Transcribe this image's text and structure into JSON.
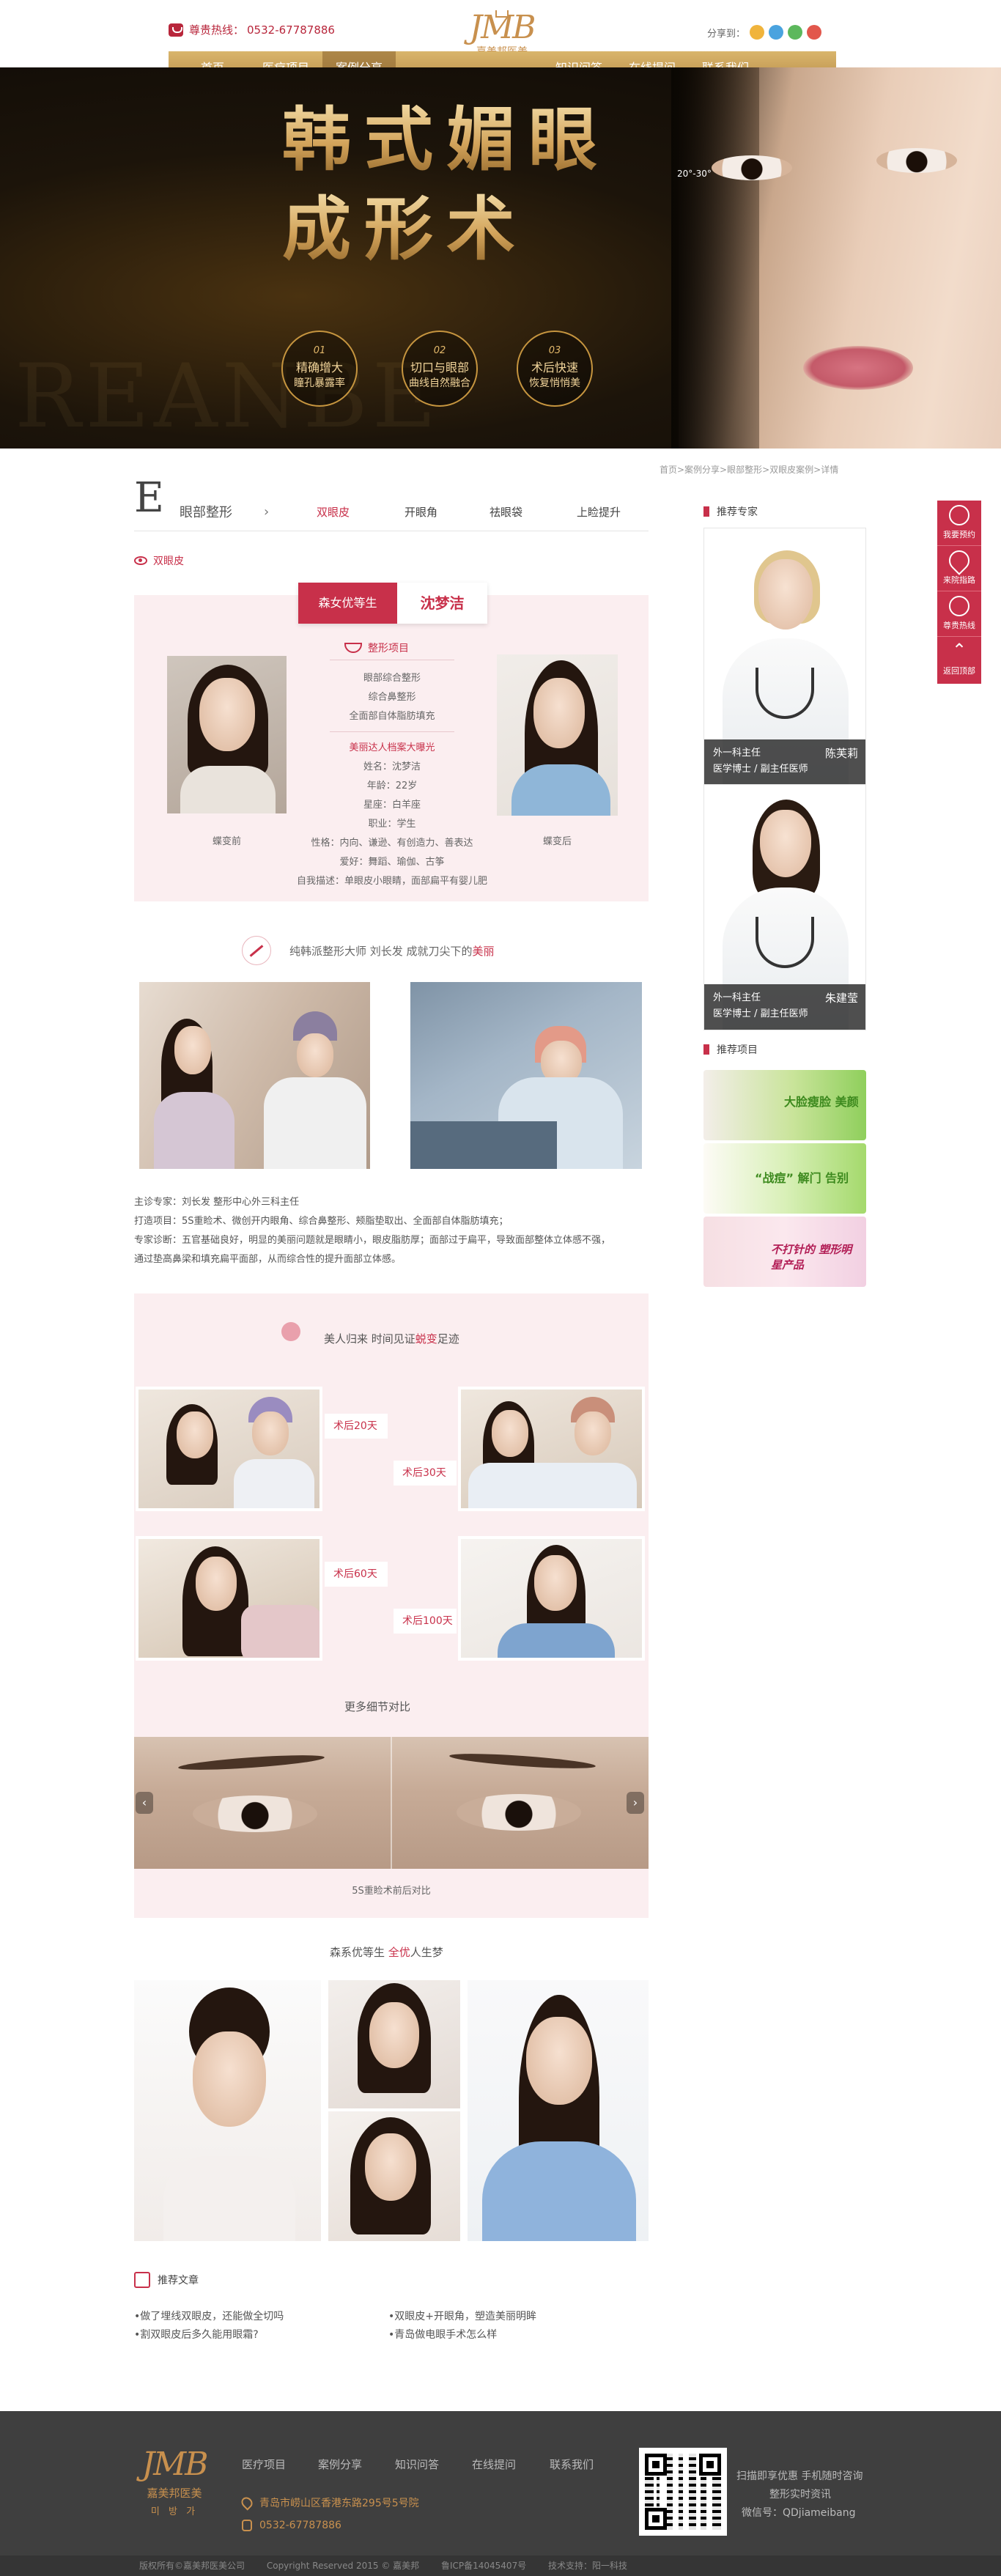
{
  "header": {
    "hotline_label": "尊贵热线：",
    "hotline_number": "0532-67787886",
    "logo_mark": "JMB",
    "logo_name": "嘉美邦医美",
    "share_label": "分享到："
  },
  "nav": [
    "首页",
    "医疗项目",
    "案例分享",
    "知识问答",
    "在线提问",
    "联系我们"
  ],
  "banner": {
    "title_line1": "韩式媚眼",
    "title_line2": "成形术",
    "angle": "20°-30°",
    "bg_text": "REANBE",
    "features": [
      {
        "num": "01",
        "l1": "精确增大",
        "l2": "瞳孔暴露率"
      },
      {
        "num": "02",
        "l1": "切口与眼部",
        "l2": "曲线自然融合"
      },
      {
        "num": "03",
        "l1": "术后快速",
        "l2": "恢复悄悄美"
      }
    ]
  },
  "breadcrumb": "首页>案例分享>眼部整形>双眼皮案例>详情",
  "section": {
    "letter": "E",
    "title": "眼部整形",
    "tabs": [
      "双眼皮",
      "开眼角",
      "祛眼袋",
      "上睑提升"
    ],
    "active_tab": "双眼皮",
    "sub_title": "双眼皮"
  },
  "case": {
    "tag_left": "森女优等生",
    "tag_right": "沈梦洁",
    "project_title": "整形项目",
    "projects": [
      "眼部综合整形",
      "综合鼻整形",
      "全面部自体脂肪填充"
    ],
    "archive_title": "美丽达人档案大曝光",
    "profile": [
      "姓名：沈梦洁",
      "年龄：22岁",
      "星座：白羊座",
      "职业：学生",
      "性格：内向、谦逊、有创造力、善表达",
      "爱好：舞蹈、瑜伽、古筝",
      "自我描述：单眼皮小眼睛，面部扁平有婴儿肥"
    ],
    "before_label": "蝶变前",
    "after_label": "蝶变后"
  },
  "slogan": {
    "prefix": "纯韩派整形大师 刘长发 成就刀尖下的",
    "highlight": "美丽"
  },
  "description": [
    "主诊专家：刘长发 整形中心外三科主任",
    "打造项目：5S重睑术、微创开内眼角、综合鼻整形、颊脂垫取出、全面部自体脂肪填充；",
    "专家诊断：五官基础良好，明显的美丽问题就是眼睛小，眼皮脂肪厚；面部过于扁平，导致面部整体立体感不强，",
    "通过垫高鼻梁和填充扁平面部，从而综合性的提升面部立体感。"
  ],
  "timeline": {
    "head_prefix": "美人归来 时间见证",
    "head_highlight": "蜕变",
    "head_suffix": "足迹",
    "labels": [
      "术后20天",
      "术后30天",
      "术后60天",
      "术后100天"
    ],
    "more": "更多细节对比",
    "strip_caption": "5S重睑术前后对比"
  },
  "joy": {
    "prefix": "森系优等生 ",
    "highlight": "全优",
    "suffix": "人生梦"
  },
  "articles": {
    "title": "推荐文章",
    "items": [
      "•做了埋线双眼皮，还能做全切吗",
      "•双眼皮+开眼角，塑造美丽明眸",
      "•割双眼皮后多久能用眼霜?",
      "•青岛做电眼手术怎么样"
    ]
  },
  "sidebar": {
    "experts_title": "推荐专家",
    "experts": [
      {
        "role": "外一科主任",
        "title": "医学博士 / 副主任医师",
        "name": "陈芙莉"
      },
      {
        "role": "外一科主任",
        "title": "医学博士 / 副主任医师",
        "name": "朱建莹"
      }
    ],
    "projects_title": "推荐项目",
    "promos": [
      {
        "text": "大脸瘦脸 美颜"
      },
      {
        "text": "“战痘” 解门 告别"
      },
      {
        "text": "不打针的 塑形明星产品"
      }
    ]
  },
  "float": [
    "我要预约",
    "来院指路",
    "尊贵热线",
    "返回顶部"
  ],
  "footer": {
    "logo_mark": "JMB",
    "logo_name": "嘉美邦医美",
    "logo_korean": "미 방 가",
    "nav": [
      "医疗项目",
      "案例分享",
      "知识问答",
      "在线提问",
      "联系我们"
    ],
    "address": "青岛市崂山区香港东路295号5号院",
    "phone": "0532-67787886",
    "qr_lines": [
      "扫描即享优惠 手机随时咨询",
      "整形实时资讯",
      "微信号：QDjiameibang"
    ],
    "copyright": [
      "版权所有©嘉美邦医美公司",
      "Copyright Reserved 2015 © 嘉美邦",
      "鲁ICP备14045407号",
      "技术支持：阳一科技"
    ]
  },
  "colors": {
    "accent": "#c8304a",
    "gold": "#c8904e",
    "pink_bg": "#fbeef0",
    "footer": "#3f3f3f"
  }
}
